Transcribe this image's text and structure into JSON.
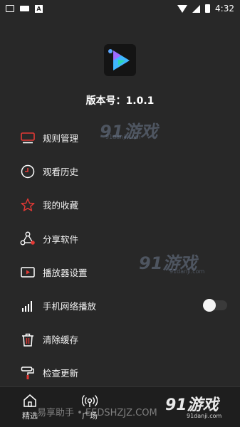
{
  "status_bar": {
    "time": "4:32"
  },
  "app": {
    "version_text": "版本号：1.0.1"
  },
  "menu": [
    {
      "label": "规则管理",
      "icon": "monitor-icon"
    },
    {
      "label": "观看历史",
      "icon": "clock-icon"
    },
    {
      "label": "我的收藏",
      "icon": "star-icon"
    },
    {
      "label": "分享软件",
      "icon": "share-icon"
    },
    {
      "label": "播放器设置",
      "icon": "play-screen-icon"
    },
    {
      "label": "手机网络播放",
      "icon": "signal-bars-icon",
      "toggle": false
    },
    {
      "label": "清除缓存",
      "icon": "trash-icon"
    },
    {
      "label": "检查更新",
      "icon": "paint-roller-icon"
    }
  ],
  "bottom_nav": [
    {
      "label": "精选",
      "icon": "home-icon"
    },
    {
      "label": "广场",
      "icon": "broadcast-icon"
    }
  ],
  "watermarks": {
    "brand": "91游戏",
    "site": "91danji.com",
    "footer": "易享助手 • EEDSHZJZ.COM"
  },
  "colors": {
    "accent": "#e53935",
    "background": "#282828"
  }
}
